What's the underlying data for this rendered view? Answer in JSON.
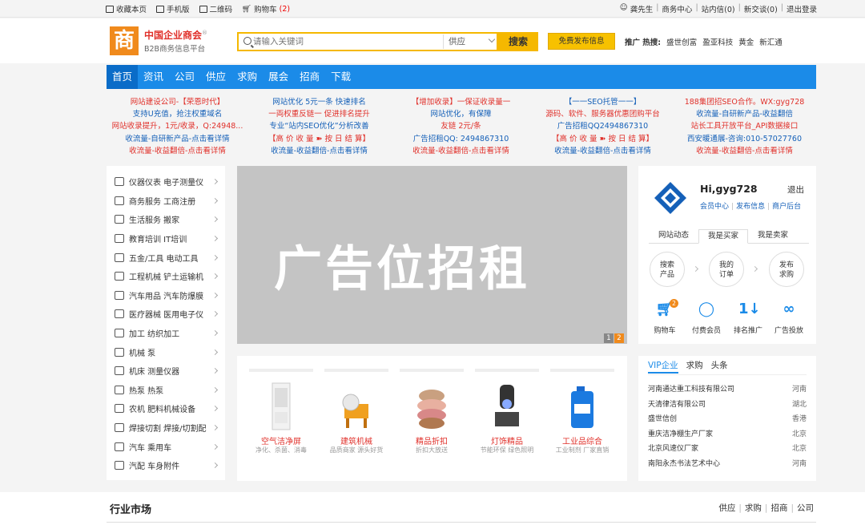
{
  "topbar": {
    "bookmark": "收藏本页",
    "mobile": "手机版",
    "qrcode": "二维码",
    "cart_label": "购物车",
    "cart_count": "(2)",
    "user": "龚先生",
    "links": [
      "商务中心",
      "站内信(0)",
      "新交谈(0)",
      "退出登录"
    ]
  },
  "logo": {
    "glyph": "商",
    "title": "中国企业商会",
    "reg": "®",
    "subtitle": "B2B商务信息平台"
  },
  "search": {
    "placeholder": "请输入关键词",
    "type": "供应",
    "button": "搜索"
  },
  "publish_button": "免费发布信息",
  "hot": {
    "label": "推广 热搜:",
    "words": [
      "盛世创富",
      "盈亚科技",
      "黄金",
      "新汇通"
    ]
  },
  "nav": [
    "首页",
    "资讯",
    "公司",
    "供应",
    "求购",
    "展会",
    "招商",
    "下载"
  ],
  "ads": [
    [
      "网站建设公司-【荣恩时代】",
      "支持U充值，抢注权重域名",
      "网站收录提升，1元/收录，Q:24948...",
      "收流量-自研新产品-点击看详情",
      "收流量-收益翻倍-点击看详情"
    ],
    [
      "网站优化 5元一条 快速排名",
      "一両权重反链一 促进排名提升",
      "专业“站内SEO优化”分析改善",
      "【高 价 收 量 ➽ 按 日 结 算】",
      "收流量-收益翻倍-点击看详情"
    ],
    [
      "【增加收录】一保证收录量一",
      "网站优化，有保障",
      "友链 2元/条",
      "广告招租QQ: 2494867310",
      "收流量-收益翻倍-点击看详情"
    ],
    [
      "【一一SEO托管一一】",
      "源码、软件、服务器优惠团购平台",
      "广告招租QQ2494867310",
      "【高 价 收 量 ➽ 按 日 结 算】",
      "收流量-收益翻倍-点击看详情"
    ],
    [
      "188集团招SEO合作。WX:gyg728",
      "收流量-自研新产品-收益翻倍",
      "站长工具开放平台_API数据接口",
      "西安暖通展-咨询:010-57027760",
      "收流量-收益翻倍-点击看详情"
    ]
  ],
  "categories": [
    "仪器仪表 电子测量仪",
    "商务服务 工商注册",
    "生活服务 搬家",
    "教育培训 IT培训",
    "五金/工具 电动工具",
    "工程机械 铲土运输机",
    "汽车用品 汽车防爆膜",
    "医疗器械 医用电子仪",
    "加工 纺织加工",
    "机械 泵",
    "机床 测量仪器",
    "热泵 热泵",
    "农机 肥料机械设备",
    "焊接切割 焊接/切割配",
    "汽车 乘用车",
    "汽配 车身附件"
  ],
  "banner": {
    "text": "广告位招租",
    "pages": [
      "1",
      "2"
    ]
  },
  "products": [
    {
      "name": "空气洁净屏",
      "desc": "净化、杀菌、消毒"
    },
    {
      "name": "建筑机械",
      "desc": "品质商家 源头好货"
    },
    {
      "name": "精品折扣",
      "desc": "折扣大放送"
    },
    {
      "name": "灯饰精品",
      "desc": "节能环保 绿色照明"
    },
    {
      "name": "工业品综合",
      "desc": "工业制剂 厂家直销"
    }
  ],
  "user_panel": {
    "greeting": "Hi,gyg728",
    "logout": "退出",
    "links": [
      "会员中心",
      "发布信息",
      "商户后台"
    ],
    "tabs": [
      "网站动态",
      "我是买家",
      "我是卖家"
    ],
    "circles": [
      [
        "搜索",
        "产品"
      ],
      [
        "我的",
        "订单"
      ],
      [
        "发布",
        "求购"
      ]
    ],
    "tools": [
      "购物车",
      "付费会员",
      "排名推广",
      "广告投放"
    ],
    "cart_badge": "2"
  },
  "vip": {
    "tabs": [
      "VIP企业",
      "求购",
      "头条"
    ],
    "rows": [
      {
        "name": "河南通达重工科技有限公司",
        "region": "河南"
      },
      {
        "name": "天清律洁有限公司",
        "region": "湖北"
      },
      {
        "name": "盛世信创",
        "region": "香港"
      },
      {
        "name": "重庆洁净棚生产厂家",
        "region": "北京"
      },
      {
        "name": "北京风速仪厂家",
        "region": "北京"
      },
      {
        "name": "南阳永杰书法艺术中心",
        "region": "河南"
      }
    ]
  },
  "market": {
    "title": "行业市场",
    "links": [
      "供应",
      "求购",
      "招商",
      "公司"
    ]
  },
  "colors": {
    "brand_blue": "#1b8be8",
    "brand_orange": "#f08a1c",
    "search_yellow": "#f5b800",
    "ad_red": "#e0302a",
    "ad_blue": "#1560b8"
  }
}
